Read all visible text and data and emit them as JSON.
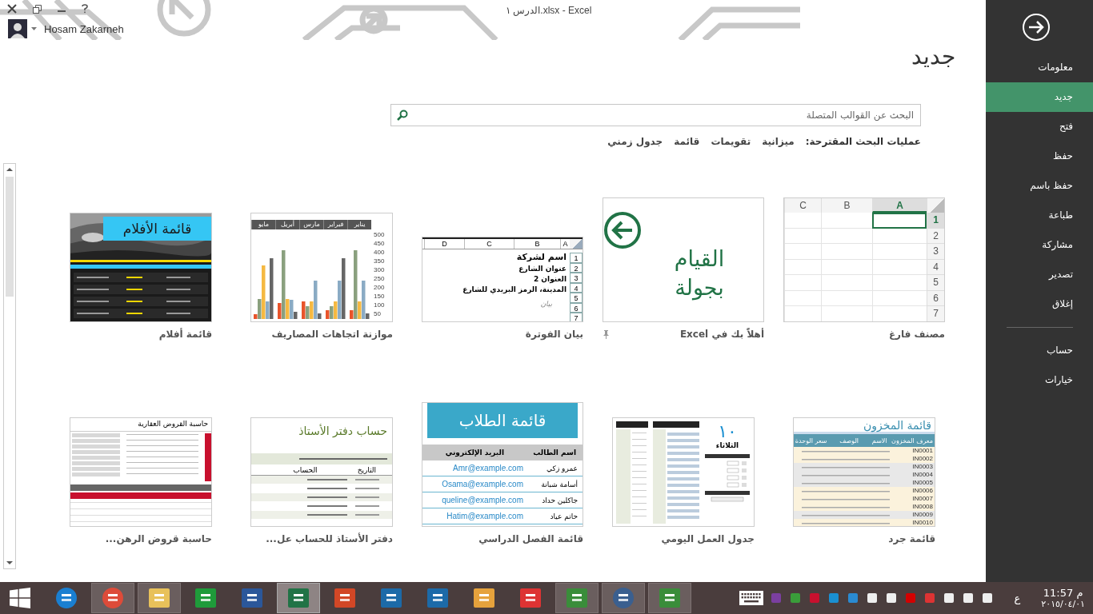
{
  "window": {
    "title": "الدرس ١.xlsx - Excel"
  },
  "user": {
    "name": "Hosam Zakarneh"
  },
  "heading": "جديد",
  "search": {
    "placeholder": "البحث عن القوالب المتصلة"
  },
  "suggestions": {
    "label": "عمليات البحث المقترحة:",
    "links": [
      "ميزانية",
      "تقويمات",
      "قائمة",
      "جدول زمني"
    ]
  },
  "templates": [
    {
      "kind": "blank",
      "label": "مصنف فارغ",
      "pinned": false,
      "columns": [
        "A",
        "B",
        "C"
      ],
      "rows": [
        "1",
        "2",
        "3",
        "4",
        "5",
        "6",
        "7"
      ]
    },
    {
      "kind": "tour",
      "label": "أهلاً بك في Excel",
      "pinned": true,
      "text": "القيام بجولة"
    },
    {
      "kind": "invoice",
      "label": "بيان الفوترة",
      "pinned": false,
      "columns": [
        "A",
        "B",
        "C",
        "D"
      ],
      "rows": [
        "1",
        "2",
        "3",
        "4",
        "5",
        "6",
        "7"
      ],
      "lines": [
        "اسم لشركة",
        "عنوان الشارع",
        "العنوان 2",
        "المدينة، الرمز البريدي للشارع"
      ],
      "signature": "بيان"
    },
    {
      "kind": "chart",
      "label": "موازنة اتجاهات المصاريف",
      "pinned": false,
      "months": [
        "يناير",
        "فبراير",
        "مارس",
        "أبريل",
        "مايو"
      ],
      "yticks": [
        "500",
        "450",
        "400",
        "350",
        "300",
        "250",
        "200",
        "150",
        "100",
        "50"
      ]
    },
    {
      "kind": "movies",
      "label": "قائمة أفلام",
      "pinned": false,
      "title": "قائمة الأفلام"
    },
    {
      "kind": "inventory",
      "label": "قائمة جرد",
      "pinned": false,
      "title": "قائمة المخزون",
      "headers": [
        "معرف المخزون",
        "الاسم",
        "الوصف",
        "سعر الوحدة"
      ],
      "ids": [
        "IN0001",
        "IN0002",
        "IN0003",
        "IN0004",
        "IN0005",
        "IN0006",
        "IN0007",
        "IN0008",
        "IN0009",
        "IN0010"
      ]
    },
    {
      "kind": "daily",
      "label": "جدول العمل اليومي",
      "pinned": false,
      "day": "١٠",
      "weekday": "الثلاثاء"
    },
    {
      "kind": "students",
      "label": "قائمة الفصل الدراسي",
      "pinned": false,
      "title": "قائمة الطلاب",
      "headers": [
        "اسم الطالب",
        "البريد الإلكتروني"
      ],
      "rows": [
        {
          "name": "عمرو زكي",
          "email": "Amr@example.com"
        },
        {
          "name": "أسامة شبانة",
          "email": "Osama@example.com"
        },
        {
          "name": "جاكلين حداد",
          "email": "queline@example.com"
        },
        {
          "name": "حاتم عياد",
          "email": "Hatim@example.com"
        }
      ]
    },
    {
      "kind": "ledger",
      "label": "دفتر الأستاذ للحساب عل...",
      "pinned": false,
      "title": "حساب دفتر الأستاذ",
      "headers": [
        "التاريخ",
        "الحساب"
      ]
    },
    {
      "kind": "loan",
      "label": "حاسبة قروض الرهن...",
      "pinned": false,
      "title": "حاسبة القروض العقارية"
    }
  ],
  "sidebar": {
    "items": [
      {
        "label": "معلومات",
        "selected": false
      },
      {
        "label": "جديد",
        "selected": true
      },
      {
        "label": "فتح",
        "selected": false
      },
      {
        "label": "حفظ",
        "selected": false
      },
      {
        "label": "حفظ باسم",
        "selected": false
      },
      {
        "label": "طباعة",
        "selected": false
      },
      {
        "label": "مشاركة",
        "selected": false
      },
      {
        "label": "تصدير",
        "selected": false
      },
      {
        "label": "إغلاق",
        "selected": false
      }
    ],
    "footer_items": [
      {
        "label": "حساب",
        "selected": false
      },
      {
        "label": "خيارات",
        "selected": false
      }
    ]
  },
  "taskbar": {
    "apps": [
      {
        "open": false,
        "selected": false
      },
      {
        "open": true,
        "selected": false
      },
      {
        "open": true,
        "selected": false
      },
      {
        "open": false,
        "selected": false
      },
      {
        "open": false,
        "selected": false
      },
      {
        "open": true,
        "selected": true
      },
      {
        "open": false,
        "selected": false
      },
      {
        "open": false,
        "selected": false
      },
      {
        "open": false,
        "selected": false
      },
      {
        "open": false,
        "selected": false
      },
      {
        "open": false,
        "selected": false
      },
      {
        "open": true,
        "selected": false
      },
      {
        "open": true,
        "selected": false
      },
      {
        "open": true,
        "selected": false
      }
    ],
    "language": "ع",
    "time": "11:57 م",
    "date": "٢٠١٥/٠٤/٠١"
  }
}
